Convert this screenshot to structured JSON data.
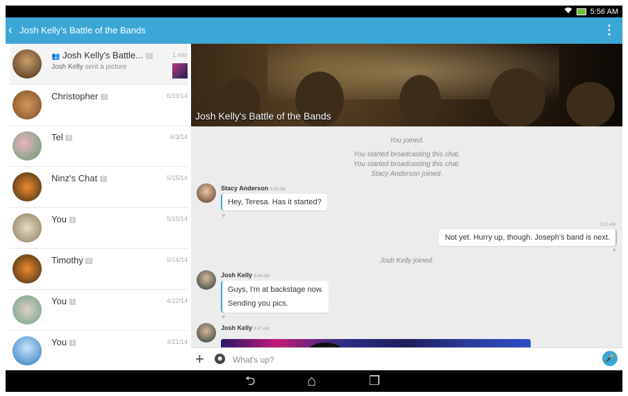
{
  "status_bar": {
    "time": "5:56 AM",
    "wifi_icon": "wifi-icon",
    "battery_icon": "battery-icon"
  },
  "app_bar": {
    "title": "Josh Kelly's Battle of the Bands",
    "back_icon": "back-arrow-icon",
    "menu_icon": "overflow-menu-icon"
  },
  "conversations": [
    {
      "name": "Josh Kelly's Battle...",
      "badge": "2",
      "date": "1 min",
      "sub_name": "Josh Kelly",
      "sub_text": "sent a picture",
      "avatar_color": "#7a4a2a"
    },
    {
      "name": "Christopher",
      "badge": "2",
      "date": "6/19/14",
      "avatar_color": "#b87038"
    },
    {
      "name": "Tel",
      "badge": "2",
      "date": "6/3/14",
      "avatar_color": "#d98aa0"
    },
    {
      "name": "Ninz's Chat",
      "badge": "2",
      "date": "5/15/14",
      "avatar_color": "#e07a30"
    },
    {
      "name": "You",
      "badge": "1",
      "date": "5/15/14",
      "avatar_color": "#c8b89a"
    },
    {
      "name": "Timothy",
      "badge": "2",
      "date": "5/14/14",
      "avatar_color": "#e07a30"
    },
    {
      "name": "You",
      "badge": "1",
      "date": "4/22/14",
      "avatar_color": "#8cb0a0"
    },
    {
      "name": "You",
      "badge": "1",
      "date": "4/21/14",
      "avatar_color": "#5aa0d8"
    }
  ],
  "chat": {
    "banner_title": "Josh Kelly's Battle of the Bands",
    "system_1": "You joined.",
    "system_2": "You started broadcasting this chat.",
    "system_3": "You started broadcasting this chat.",
    "system_4": "Stacy Anderson joined.",
    "msg1": {
      "sender": "Stacy Anderson",
      "time": "5:10 AM",
      "text": "Hey, Teresa. Has it started?"
    },
    "msg2": {
      "time": "5:11 AM",
      "text": "Not yet. Hurry up, though. Joseph's band is next."
    },
    "system_5": "Josh Kelly joined.",
    "msg3": {
      "sender": "Josh Kelly",
      "time": "5:46 AM",
      "line1": "Guys, I'm at backstage now.",
      "line2": "Sending you pics."
    },
    "msg4": {
      "sender": "Josh Kelly",
      "time": "5:47 AM"
    }
  },
  "input": {
    "placeholder": "What's up?"
  },
  "nav": {
    "back": "⮌",
    "home": "⌂",
    "recents": "❐"
  },
  "colors": {
    "accent": "#3ba7d6",
    "status_bar": "#000000"
  }
}
